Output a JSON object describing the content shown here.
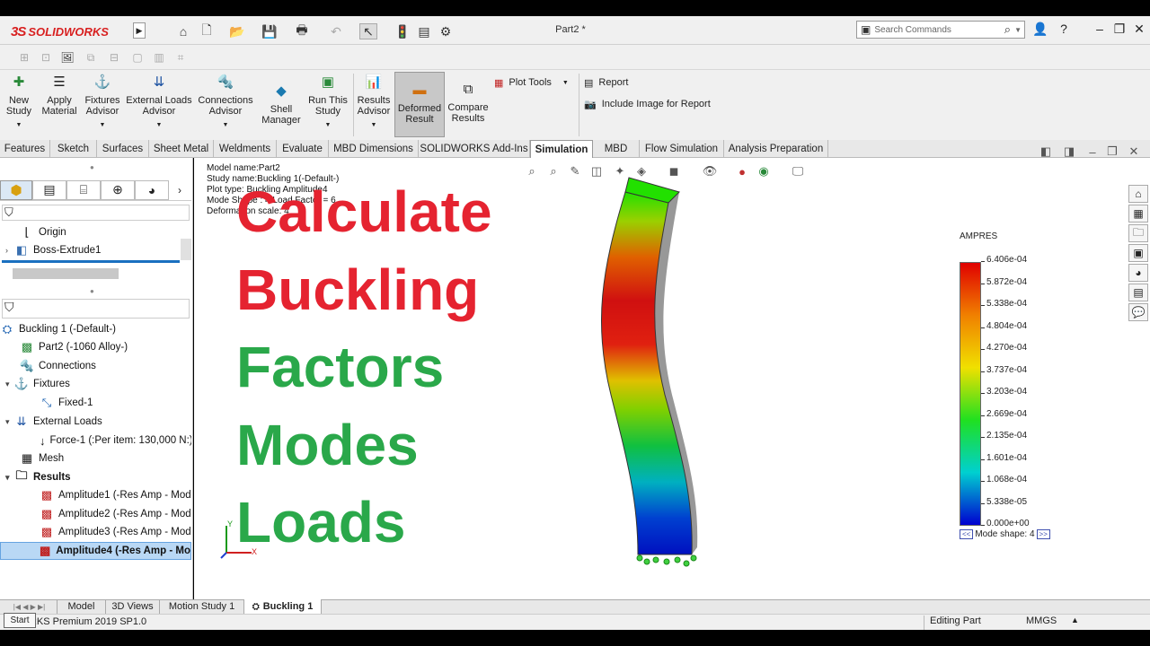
{
  "app": {
    "brand_prefix": "3S",
    "brand": "SOLIDWORKS",
    "doc_title": "Part2 *"
  },
  "search": {
    "placeholder": "Search Commands"
  },
  "window": {
    "help": "?"
  },
  "commands": [
    {
      "label": "New\nStudy"
    },
    {
      "label": "Apply\nMaterial"
    },
    {
      "label": "Fixtures\nAdvisor"
    },
    {
      "label": "External Loads\nAdvisor"
    },
    {
      "label": "Connections\nAdvisor"
    },
    {
      "label": "Shell\nManager"
    },
    {
      "label": "Run This\nStudy"
    },
    {
      "label": "Results\nAdvisor"
    },
    {
      "label": "Deformed\nResult"
    },
    {
      "label": "Compare\nResults"
    }
  ],
  "plot_tools": "Plot Tools",
  "report": "Report",
  "include_image": "Include Image for Report",
  "tabs": [
    "Features",
    "Sketch",
    "Surfaces",
    "Sheet Metal",
    "Weldments",
    "Evaluate",
    "MBD Dimensions",
    "SOLIDWORKS Add-Ins",
    "Simulation",
    "MBD",
    "Flow Simulation",
    "Analysis Preparation"
  ],
  "feature_tree": {
    "origin": "Origin",
    "boss": "Boss-Extrude1"
  },
  "sim_tree": {
    "study": "Buckling 1 (-Default-)",
    "part": "Part2 (-1060 Alloy-)",
    "connections": "Connections",
    "fixtures": "Fixtures",
    "fixed": "Fixed-1",
    "external_loads": "External Loads",
    "force": "Force-1 (:Per item: 130,000 N:)",
    "mesh": "Mesh",
    "results": "Results",
    "amp1": "Amplitude1 (-Res Amp - Mod",
    "amp2": "Amplitude2 (-Res Amp - Mod",
    "amp3": "Amplitude3 (-Res Amp - Mod",
    "amp4": "Amplitude4 (-Res Amp - Mo"
  },
  "model_info": {
    "l1": "Model name:Part2",
    "l2": "Study name:Buckling 1(-Default-)",
    "l3": "Plot type: Buckling Amplitude4",
    "l4": "Mode Shape : 4  Load Factor = 6",
    "l5": "Deformation scale: 4"
  },
  "overlay": {
    "w1": "Calculate",
    "w2": "Buckling",
    "w3": "Factors",
    "w4": "Modes",
    "w5": "Loads",
    "red": "#e52330",
    "green": "#2aa84a"
  },
  "legend": {
    "title": "AMPRES",
    "labels": [
      "6.406e-04",
      "5.872e-04",
      "5.338e-04",
      "4.804e-04",
      "4.270e-04",
      "3.737e-04",
      "3.203e-04",
      "2.669e-04",
      "2.135e-04",
      "1.601e-04",
      "1.068e-04",
      "5.338e-05",
      "0.000e+00"
    ],
    "mode_shape": "Mode shape: 4",
    "prev": "<<",
    "next": ">>"
  },
  "bottom_tabs": [
    "Model",
    "3D Views",
    "Motion Study 1",
    "Buckling 1"
  ],
  "status": {
    "product": "WORKS Premium 2019 SP1.0",
    "start": "Start",
    "editing": "Editing Part",
    "units": "MMGS"
  },
  "triad": {
    "y": "Y",
    "x": "X"
  }
}
